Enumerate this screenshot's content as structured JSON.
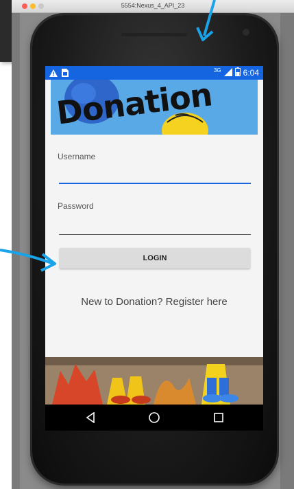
{
  "emulator": {
    "title": "5554:Nexus_4_API_23"
  },
  "statusbar": {
    "network": "3G",
    "time": "6:04"
  },
  "banner": {
    "text": "Donation"
  },
  "form": {
    "username_label": "Username",
    "password_label": "Password",
    "login_label": "LOGIN",
    "register_text": "New to Donation? Register here"
  },
  "icons": {
    "warning": "warning-icon",
    "sim": "sim-card-icon",
    "signal": "signal-icon",
    "battery": "battery-icon",
    "back": "back-icon",
    "home": "home-icon",
    "recents": "recents-icon"
  },
  "colors": {
    "statusbar": "#1565e0",
    "accent": "#1565e0",
    "arrow": "#1aa3e8",
    "banner_sky": "#58a9e6"
  }
}
